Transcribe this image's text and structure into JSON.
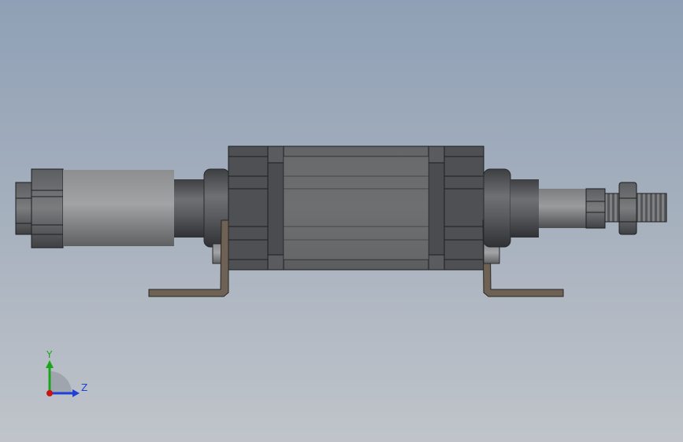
{
  "triad": {
    "y_label": "Y",
    "z_label": "Z",
    "y_color": "#1aa51a",
    "z_color": "#1f3fd6",
    "x_color": "#c81414"
  },
  "colors": {
    "background_top": "#8fa0b6",
    "background_bottom": "#c0c4ca",
    "body_dark": "#4b4d50",
    "body_mid": "#6a6c6f",
    "bracket": "#6d6255"
  }
}
